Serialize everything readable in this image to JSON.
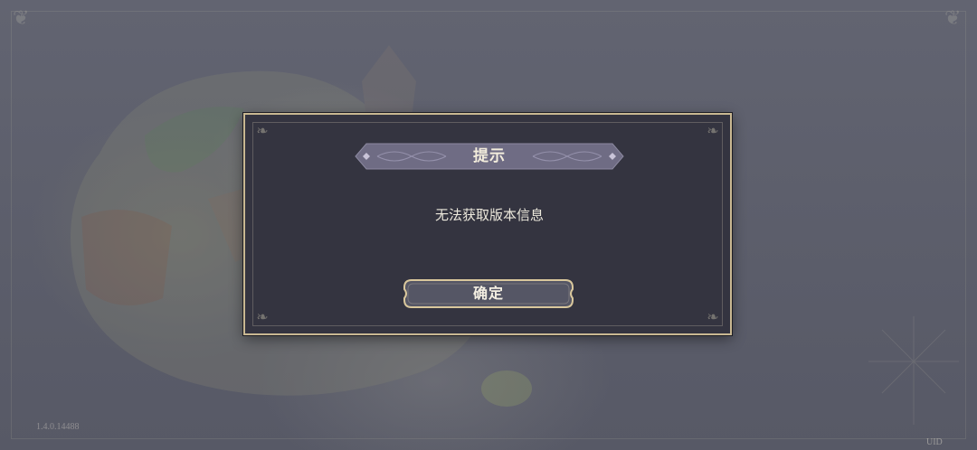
{
  "dialog": {
    "title": "提示",
    "message": "无法获取版本信息",
    "confirm_label": "确定"
  },
  "footer": {
    "version": "1.4.0.14488",
    "uid_label": "UID"
  },
  "colors": {
    "dialog_bg": "#343440",
    "dialog_border": "#c9b892",
    "title_banner": "#6f6c84",
    "button_fill": "#555665",
    "overlay": "#5c5e6c"
  },
  "icons": {
    "corner": "fleur-corner-ornament"
  }
}
